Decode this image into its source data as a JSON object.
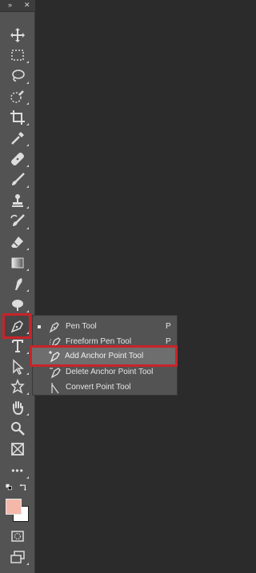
{
  "toolbar": {
    "header_icons": [
      "double-chevron-icon",
      "close-icon"
    ],
    "header": {
      "collapse_glyph": "»",
      "close_glyph": "✕"
    },
    "tools": [
      "move-tool-icon",
      "rectangular-marquee-tool-icon",
      "lasso-tool-icon",
      "quick-selection-tool-icon",
      "crop-tool-icon",
      "eyedropper-tool-icon",
      "healing-brush-tool-icon",
      "brush-tool-icon",
      "clone-stamp-tool-icon",
      "history-brush-tool-icon",
      "eraser-tool-icon",
      "gradient-tool-icon",
      "smudge-tool-icon",
      "dodge-tool-icon",
      "pen-tool-icon",
      "type-tool-icon",
      "path-selection-tool-icon",
      "custom-shape-tool-icon",
      "hand-tool-icon",
      "zoom-tool-icon",
      "frame-tool-icon",
      "edit-toolbar-icon",
      "quick-mask-icon",
      "screen-mode-icon"
    ],
    "selected_tool": "pen-tool-icon",
    "foreground_color": "#f3b8aa",
    "background_color": "#ffffff",
    "highlight_color": "#c8232a",
    "more_label": "•••"
  },
  "flyout": {
    "items": [
      {
        "label": "Pen Tool",
        "shortcut": "P",
        "icon": "pen-tool-icon",
        "active": true
      },
      {
        "label": "Freeform Pen Tool",
        "shortcut": "P",
        "icon": "freeform-pen-tool-icon",
        "active": false
      },
      {
        "label": "Add Anchor Point Tool",
        "shortcut": "",
        "icon": "add-anchor-point-tool-icon",
        "active": false,
        "hovered": true
      },
      {
        "label": "Delete Anchor Point Tool",
        "shortcut": "",
        "icon": "delete-anchor-point-tool-icon",
        "active": false
      },
      {
        "label": "Convert Point Tool",
        "shortcut": "",
        "icon": "convert-point-tool-icon",
        "active": false
      }
    ]
  }
}
